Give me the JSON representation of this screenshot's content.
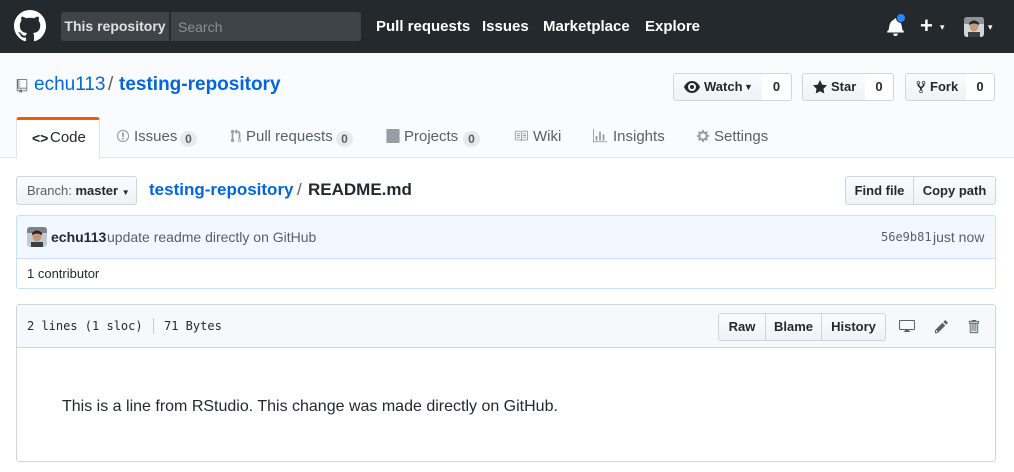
{
  "topnav": {
    "scope_label": "This repository",
    "search_placeholder": "Search",
    "links": [
      "Pull requests",
      "Issues",
      "Marketplace",
      "Explore"
    ],
    "new_caret": "▾",
    "avatar_caret": "▾"
  },
  "repo": {
    "owner": "echu113",
    "separator": "/",
    "name": "testing-repository",
    "watch_label": "Watch",
    "watch_count": "0",
    "star_label": "Star",
    "star_count": "0",
    "fork_label": "Fork",
    "fork_count": "0"
  },
  "tabs": {
    "code": "Code",
    "issues": "Issues",
    "issues_count": "0",
    "pulls": "Pull requests",
    "pulls_count": "0",
    "projects": "Projects",
    "projects_count": "0",
    "wiki": "Wiki",
    "insights": "Insights",
    "settings": "Settings"
  },
  "filenav": {
    "branch_prefix": "Branch:",
    "branch_name": "master",
    "crumb_repo": "testing-repository",
    "crumb_sep": "/",
    "crumb_file": "README.md",
    "find_file": "Find file",
    "copy_path": "Copy path"
  },
  "commit": {
    "author": "echu113",
    "message": "update readme directly on GitHub",
    "sha": "56e9b81",
    "time": "just now",
    "contributors": "1 contributor"
  },
  "file": {
    "lines": "2 lines (1 sloc)",
    "size": "71 Bytes",
    "raw": "Raw",
    "blame": "Blame",
    "history": "History",
    "content": "This is a line from RStudio. This change was made directly on GitHub."
  },
  "colors": {
    "header_bg": "#24292e",
    "link": "#0366d6",
    "tab_accent": "#e36209",
    "notification": "#2188ff"
  }
}
